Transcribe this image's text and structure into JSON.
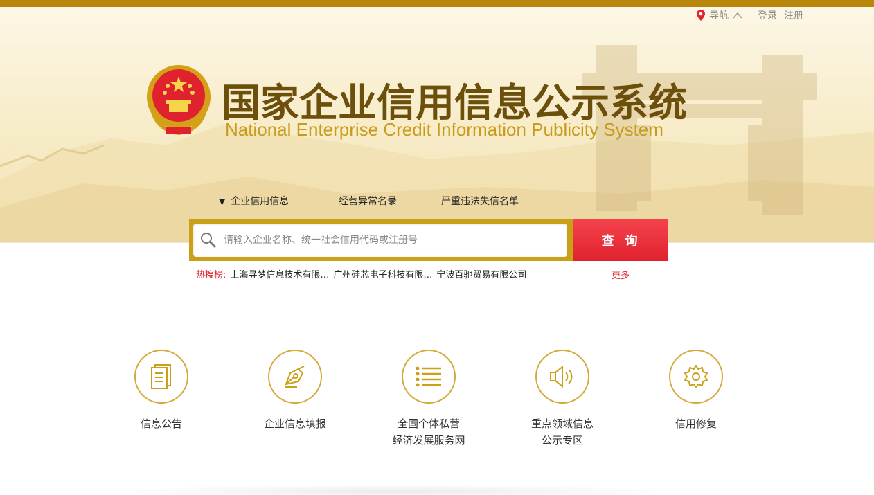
{
  "top_nav": {
    "nav_label": "导航",
    "login": "登录",
    "register": "注册"
  },
  "header": {
    "title_cn": "国家企业信用信息公示系统",
    "title_en": "National Enterprise Credit Information Publicity System"
  },
  "tabs": [
    {
      "label": "企业信用信息",
      "active": true
    },
    {
      "label": "经营异常名录",
      "active": false
    },
    {
      "label": "严重违法失信名单",
      "active": false
    }
  ],
  "search": {
    "placeholder": "请输入企业名称、统一社会信用代码或注册号",
    "value": "",
    "button_label": "查询"
  },
  "hot_search": {
    "label": "热搜榜:",
    "items": [
      "上海寻梦信息技术有限…",
      "广州硅芯电子科技有限…",
      "宁波百驰贸易有限公司"
    ],
    "more": "更多"
  },
  "services": [
    {
      "label": "信息公告",
      "icon": "document-icon"
    },
    {
      "label": "企业信息填报",
      "icon": "pen-nib-icon"
    },
    {
      "label_line1": "全国个体私营",
      "label_line2": "经济发展服务网",
      "icon": "list-icon"
    },
    {
      "label_line1": "重点领域信息",
      "label_line2": "公示专区",
      "icon": "speaker-icon"
    },
    {
      "label": "信用修复",
      "icon": "gear-icon"
    }
  ],
  "colors": {
    "gold": "#c9a018",
    "brown_title": "#6b4f0a",
    "red": "#e0222e",
    "icon_gold": "#d4a93a"
  }
}
